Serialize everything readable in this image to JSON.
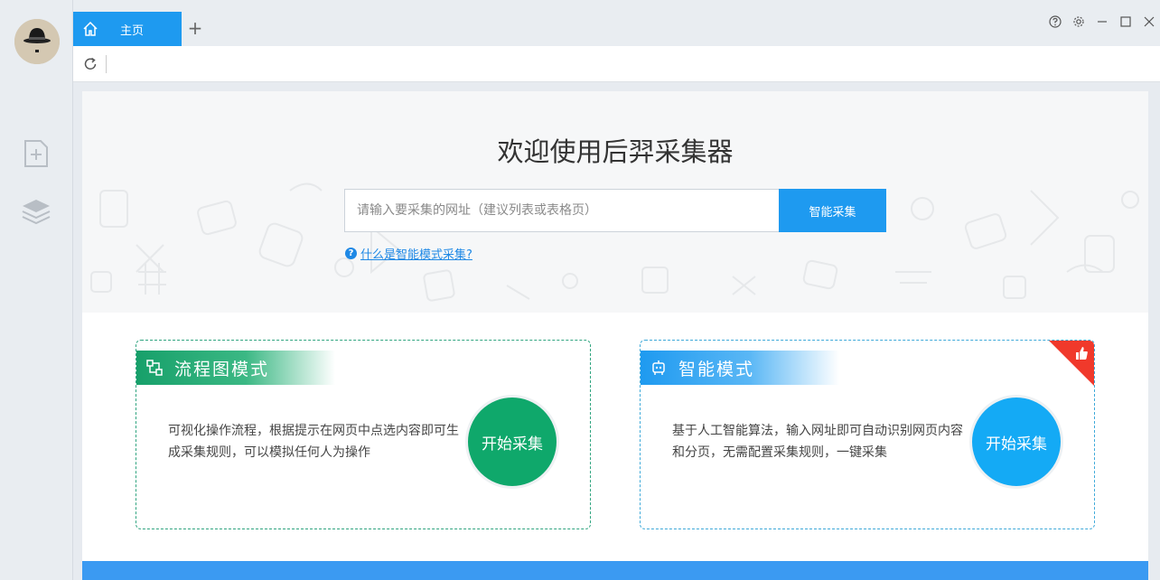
{
  "tabs": [
    {
      "label": "主页",
      "icon": "home-icon",
      "active": true
    }
  ],
  "tab_add_label": "+",
  "address_bar": {
    "value": ""
  },
  "hero": {
    "title": "欢迎使用后羿采集器",
    "search_placeholder": "请输入要采集的网址（建议列表或表格页）",
    "search_button": "智能采集",
    "help_link": "什么是智能模式采集?",
    "help_icon_glyph": "?"
  },
  "cards": {
    "flowchart": {
      "title": "流程图模式",
      "description": "可视化操作流程，根据提示在网页中点选内容即可生成采集规则，可以模拟任何人为操作",
      "button": "开始采集",
      "color": "#0fa86b"
    },
    "smart": {
      "title": "智能模式",
      "description": "基于人工智能算法，输入网址即可自动识别网页内容和分页，无需配置采集规则，一键采集",
      "button": "开始采集",
      "color": "#14aaf5"
    }
  },
  "colors": {
    "accent": "#1e9af0",
    "badge": "#f0392b"
  }
}
